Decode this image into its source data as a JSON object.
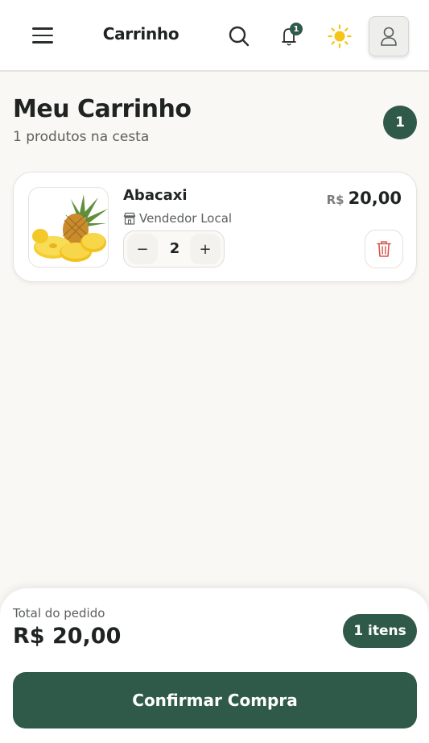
{
  "header": {
    "title": "Carrinho",
    "menu_icon": "hamburger-menu-icon",
    "search_icon": "search-icon",
    "bell_icon": "bell-icon",
    "notification_count": "1",
    "theme_icon": "sun-icon",
    "profile_icon": "user-icon"
  },
  "cart": {
    "title": "Meu Carrinho",
    "subtitle": "1 produtos na cesta",
    "count_badge": "1"
  },
  "items": [
    {
      "name": "Abacaxi",
      "vendor": "Vendedor Local",
      "vendor_icon": "store-icon",
      "quantity": "2",
      "minus_label": "−",
      "plus_label": "+",
      "currency": "R$",
      "price": "20,00",
      "delete_icon": "trash-icon"
    }
  ],
  "summary": {
    "total_label": "Total do pedido",
    "total_value": "R$ 20,00",
    "items_pill": "1 itens",
    "confirm_label": "Confirmar Compra"
  },
  "colors": {
    "primary": "#2f5a4a",
    "background": "#faf8f4",
    "sun": "#f5c518",
    "danger": "#d9534f"
  }
}
